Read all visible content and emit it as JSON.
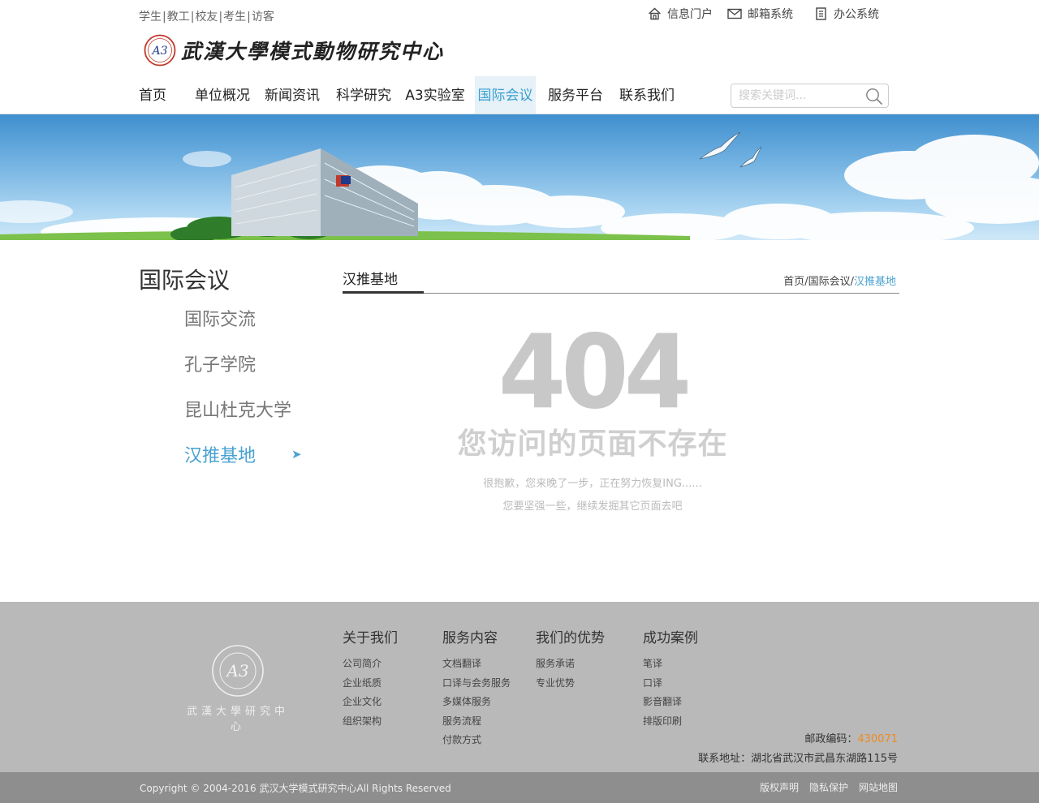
{
  "topbar": {
    "quick_links": [
      "学生",
      "教工",
      "校友",
      "考生",
      "访客"
    ],
    "portal_links": [
      {
        "label": "信息门户",
        "icon": "home-icon"
      },
      {
        "label": "邮箱系统",
        "icon": "mail-icon"
      },
      {
        "label": "办公系统",
        "icon": "document-icon"
      }
    ]
  },
  "logo": {
    "seal_text": "A3",
    "name": "武漢大學模式動物研究中心"
  },
  "nav": {
    "items": [
      "首页",
      "单位概况",
      "新闻资讯",
      "科学研究",
      "A3实验室",
      "国际会议",
      "服务平台",
      "联系我们"
    ],
    "active": "国际会议",
    "search_placeholder": "搜索关键词..."
  },
  "sidebar": {
    "title": "国际会议",
    "items": [
      "国际交流",
      "孔子学院",
      "昆山杜克大学",
      "汉推基地"
    ],
    "active": "汉推基地",
    "arrow": "➤"
  },
  "content": {
    "title": "汉推基地",
    "breadcrumb": {
      "home": "首页",
      "sep1": "/",
      "parent": "国际会议",
      "sep2": "/",
      "current": "汉推基地"
    },
    "error_code": "404",
    "error_message": "您访问的页面不存在",
    "sub_line_1": "很抱歉，您来晚了一步，正在努力恢复ING......",
    "sub_line_2": "您要坚强一些，继续发掘其它页面去吧"
  },
  "footer": {
    "logo_text": "武漢大學研究中心",
    "columns": [
      {
        "title": "关于我们",
        "links": [
          "公司简介",
          "企业纸质",
          "企业文化",
          "组织架构"
        ]
      },
      {
        "title": "服务内容",
        "links": [
          "文档翻译",
          "口译与会务服务",
          "多媒体服务",
          "服务流程",
          "付款方式"
        ]
      },
      {
        "title": "我们的优势",
        "links": [
          "服务承诺",
          "专业优势"
        ]
      },
      {
        "title": "成功案例",
        "links": [
          "笔译",
          "口译",
          "影音翻译",
          "排版印刷"
        ]
      }
    ],
    "postcode_label": "邮政编码：",
    "postcode": "430071",
    "address": "联系地址：湖北省武汉市武昌东湖路115号",
    "copyright": "Copyright © 2004-2016 武汉大学模式研究中心All Rights Reserved",
    "bottom_links": [
      "版权声明",
      "隐私保护",
      "网站地图"
    ]
  },
  "colors": {
    "accent": "#4aa2d2",
    "nav_active_bg": "#e6f1f8",
    "footer_bg": "#b9b9b9",
    "copybar_bg": "#8e8e8e",
    "postcode": "#f08a22"
  }
}
